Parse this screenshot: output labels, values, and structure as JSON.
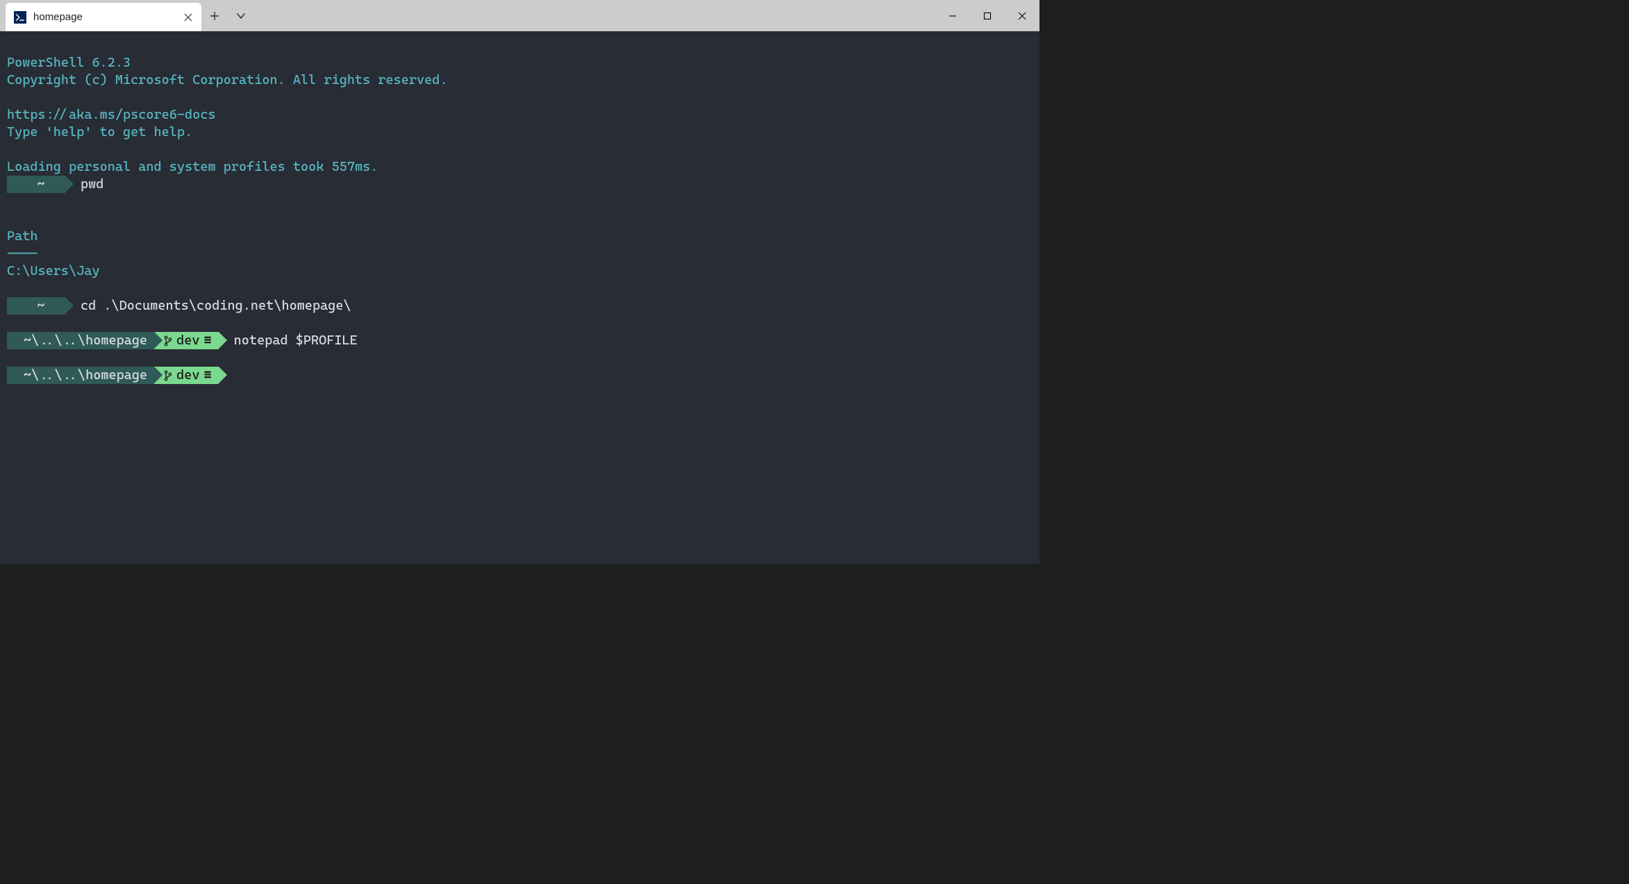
{
  "titlebar": {
    "tab_title": "homepage",
    "new_tab_label": "+",
    "dropdown_label": "v"
  },
  "terminal": {
    "banner": {
      "line1": "PowerShell 6.2.3",
      "line2": "Copyright (c) Microsoft Corporation. All rights reserved.",
      "blank1": "",
      "line3": "https://aka.ms/pscore6-docs",
      "line4": "Type 'help' to get help.",
      "blank2": "",
      "line5": "Loading personal and system profiles took 557ms."
    },
    "prompts": [
      {
        "path": "~",
        "branch": "",
        "command": "pwd"
      }
    ],
    "pwd_output": {
      "header": "Path",
      "rule": "----",
      "value": "C:\\Users\\Jay"
    },
    "prompts2": [
      {
        "path": "~",
        "branch": "",
        "command": "cd .\\Documents\\coding.net\\homepage\\"
      },
      {
        "path": "~\\..\\..\\homepage",
        "branch": "dev",
        "status": "≡",
        "command": "notepad $PROFILE"
      },
      {
        "path": "~\\..\\..\\homepage",
        "branch": "dev",
        "status": "≡",
        "command": ""
      }
    ],
    "icons": {
      "branch": "branch-icon"
    }
  }
}
